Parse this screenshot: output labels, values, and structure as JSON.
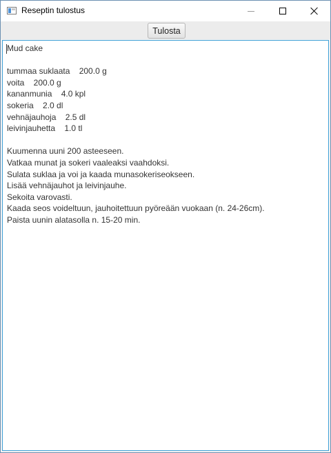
{
  "window": {
    "title": "Reseptin tulostus",
    "icon": "app-window-icon",
    "controls": [
      "minimize-icon",
      "maximize-icon",
      "close-icon"
    ]
  },
  "toolbar": {
    "print_label": "Tulosta"
  },
  "recipe": {
    "lines": [
      "Mud cake",
      "",
      "tummaa suklaata    200.0 g",
      "voita    200.0 g",
      "kananmunia    4.0 kpl",
      "sokeria    2.0 dl",
      "vehnäjauhoja    2.5 dl",
      "leivinjauhetta    1.0 tl",
      "",
      "Kuumenna uuni 200 asteeseen.",
      "Vatkaa munat ja sokeri vaaleaksi vaahdoksi.",
      "Sulata suklaa ja voi ja kaada munasokeriseokseen.",
      "Lisää vehnäjauhot ja leivinjauhe.",
      "Sekoita varovasti.",
      "Kaada seos voideltuun, jauhoitettuun pyöreään vuokaan (n. 24-26cm).",
      "Paista uunin alatasolla n. 15-20 min."
    ]
  },
  "colors": {
    "focus_border": "#3c9fd6",
    "window_border": "#6b8fb1"
  }
}
